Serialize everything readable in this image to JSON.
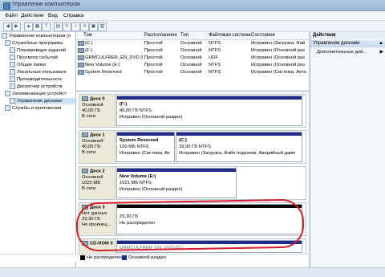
{
  "window": {
    "title": "Управление компьютером"
  },
  "menu": [
    "Файл",
    "Действие",
    "Вид",
    "Справка"
  ],
  "tree": [
    {
      "label": "Управление компьютером (л",
      "level": 0,
      "selected": false
    },
    {
      "label": "Служебные программы",
      "level": 1,
      "selected": false
    },
    {
      "label": "Планировщик заданий",
      "level": 2,
      "selected": false
    },
    {
      "label": "Просмотр событий",
      "level": 2,
      "selected": false
    },
    {
      "label": "Общие папки",
      "level": 2,
      "selected": false
    },
    {
      "label": "Локальные пользовате",
      "level": 2,
      "selected": false
    },
    {
      "label": "Производительность",
      "level": 2,
      "selected": false
    },
    {
      "label": "Диспетчер устройств",
      "level": 2,
      "selected": false
    },
    {
      "label": "Запоминающие устройст",
      "level": 1,
      "selected": false
    },
    {
      "label": "Управление дисками",
      "level": 2,
      "selected": true
    },
    {
      "label": "Службы и приложения",
      "level": 1,
      "selected": false
    }
  ],
  "table": {
    "headers": [
      "Том",
      "Расположение",
      "Тип",
      "Файловая система",
      "Состояние"
    ],
    "rows": [
      [
        "(C:)",
        "Простой",
        "Основной",
        "NTFS",
        "Исправен (Загрузка, Фай"
      ],
      [
        "(F:)",
        "Простой",
        "Основной",
        "NTFS",
        "Исправен (Основной раз"
      ],
      [
        "GRMCULFRER_EN_DVD (D:)",
        "Простой",
        "Основной",
        "UDF",
        "Исправен (Основной раз"
      ],
      [
        "New Volume (E:)",
        "Простой",
        "Основной",
        "NTFS",
        "Исправен (Основной раз"
      ],
      [
        "System Reserved",
        "Простой",
        "Основной",
        "NTFS",
        "Исправен (Система, Акти"
      ]
    ]
  },
  "disks": [
    {
      "name": "Диск 0",
      "type": "Основной",
      "size": "40,00 ГБ",
      "status": "В сети",
      "partitions": [
        {
          "title": "(F:)",
          "line1": "40,00 ГБ NTFS",
          "line2": "Исправен (Основной раздел)",
          "width": 0.97,
          "bar": "blue"
        }
      ]
    },
    {
      "name": "Диск 1",
      "type": "Основной",
      "size": "40,00 ГБ",
      "status": "В сети",
      "partitions": [
        {
          "title": "System Reserved",
          "line1": "100 МБ NTFS",
          "line2": "Исправен (Система, Ак",
          "width": 0.3,
          "bar": "blue"
        },
        {
          "title": "(C:)",
          "line1": "39,90 ГБ NTFS",
          "line2": "Исправен (Загрузка, Файл подкачки, Аварийный дамп",
          "width": 0.66,
          "bar": "blue"
        }
      ]
    },
    {
      "name": "Диск 2",
      "type": "Основной",
      "size": "1023 МБ",
      "status": "В сети",
      "partitions": [
        {
          "title": "New Volume (E:)",
          "line1": "1021 МБ NTFS",
          "line2": "Исправен (Основной раздел)",
          "width": 0.62,
          "bar": "blue"
        }
      ]
    },
    {
      "name": "Диск 3",
      "type": "Нет данных",
      "size": "29,30 ГБ",
      "status": "Не проиниц...",
      "partitions": [
        {
          "title": "",
          "line1": "29,30 ГБ",
          "line2": "Не распределен",
          "width": 0.97,
          "bar": "black"
        }
      ]
    },
    {
      "name": "CD-ROM 0",
      "type": "",
      "size": "",
      "status": "",
      "partitions": [
        {
          "title": "",
          "line1": "GRMCULFRER_EN_DVD (D:)",
          "line2": "",
          "width": 0.97,
          "bar": "blue"
        }
      ]
    }
  ],
  "legend": [
    {
      "label": "Не распределен",
      "color": "#000000"
    },
    {
      "label": "Основной раздел",
      "color": "#1f2b8a"
    }
  ],
  "actions": {
    "header": "Действия",
    "section": "Управление дисками",
    "item": "Дополнительные дей..."
  }
}
